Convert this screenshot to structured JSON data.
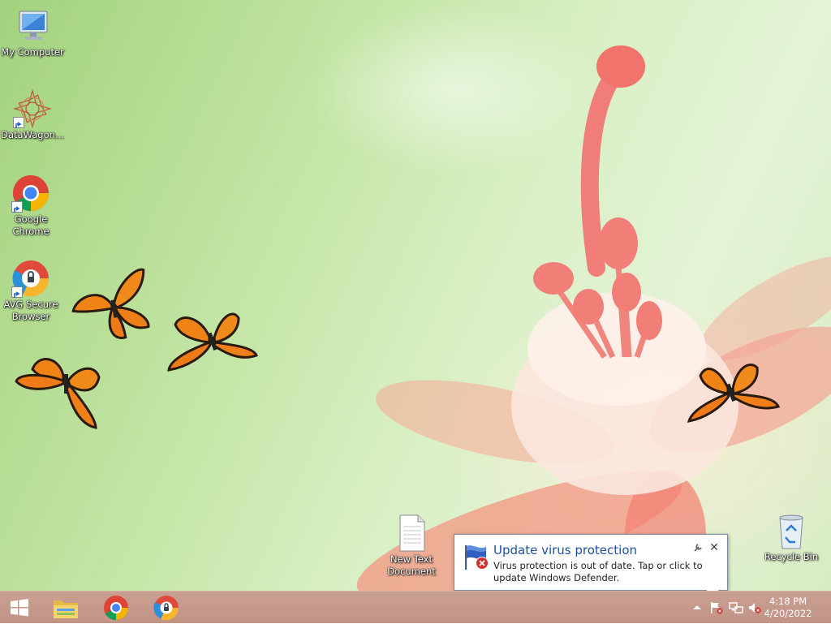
{
  "desktop": {
    "icons": [
      {
        "label": "My Computer",
        "icon": "computer-icon"
      },
      {
        "label": "DataWagon...",
        "icon": "datawagon-icon"
      },
      {
        "label": "Google\nChrome",
        "icon": "chrome-icon"
      },
      {
        "label": "AVG Secure\nBrowser",
        "icon": "avg-browser-icon"
      },
      {
        "label": "New Text\nDocument",
        "icon": "text-document-icon"
      },
      {
        "label": "Recycle Bin",
        "icon": "recycle-bin-icon"
      }
    ]
  },
  "notification": {
    "title": "Update virus protection",
    "body": "Virus protection is out of date. Tap or click to update Windows Defender.",
    "icon": "windows-defender-flag-icon"
  },
  "taskbar": {
    "pinned": [
      "start-button",
      "file-explorer-icon",
      "chrome-icon",
      "avg-browser-icon"
    ],
    "tray": [
      "show-hidden-icons",
      "action-center-flag-icon",
      "network-icon",
      "volume-muted-icon"
    ],
    "time": "4:18 PM",
    "date": "4/20/2022"
  },
  "colors": {
    "taskbar": "#c39687",
    "toast_title": "#1e4fa8",
    "desktop": "#c1e4a2"
  }
}
